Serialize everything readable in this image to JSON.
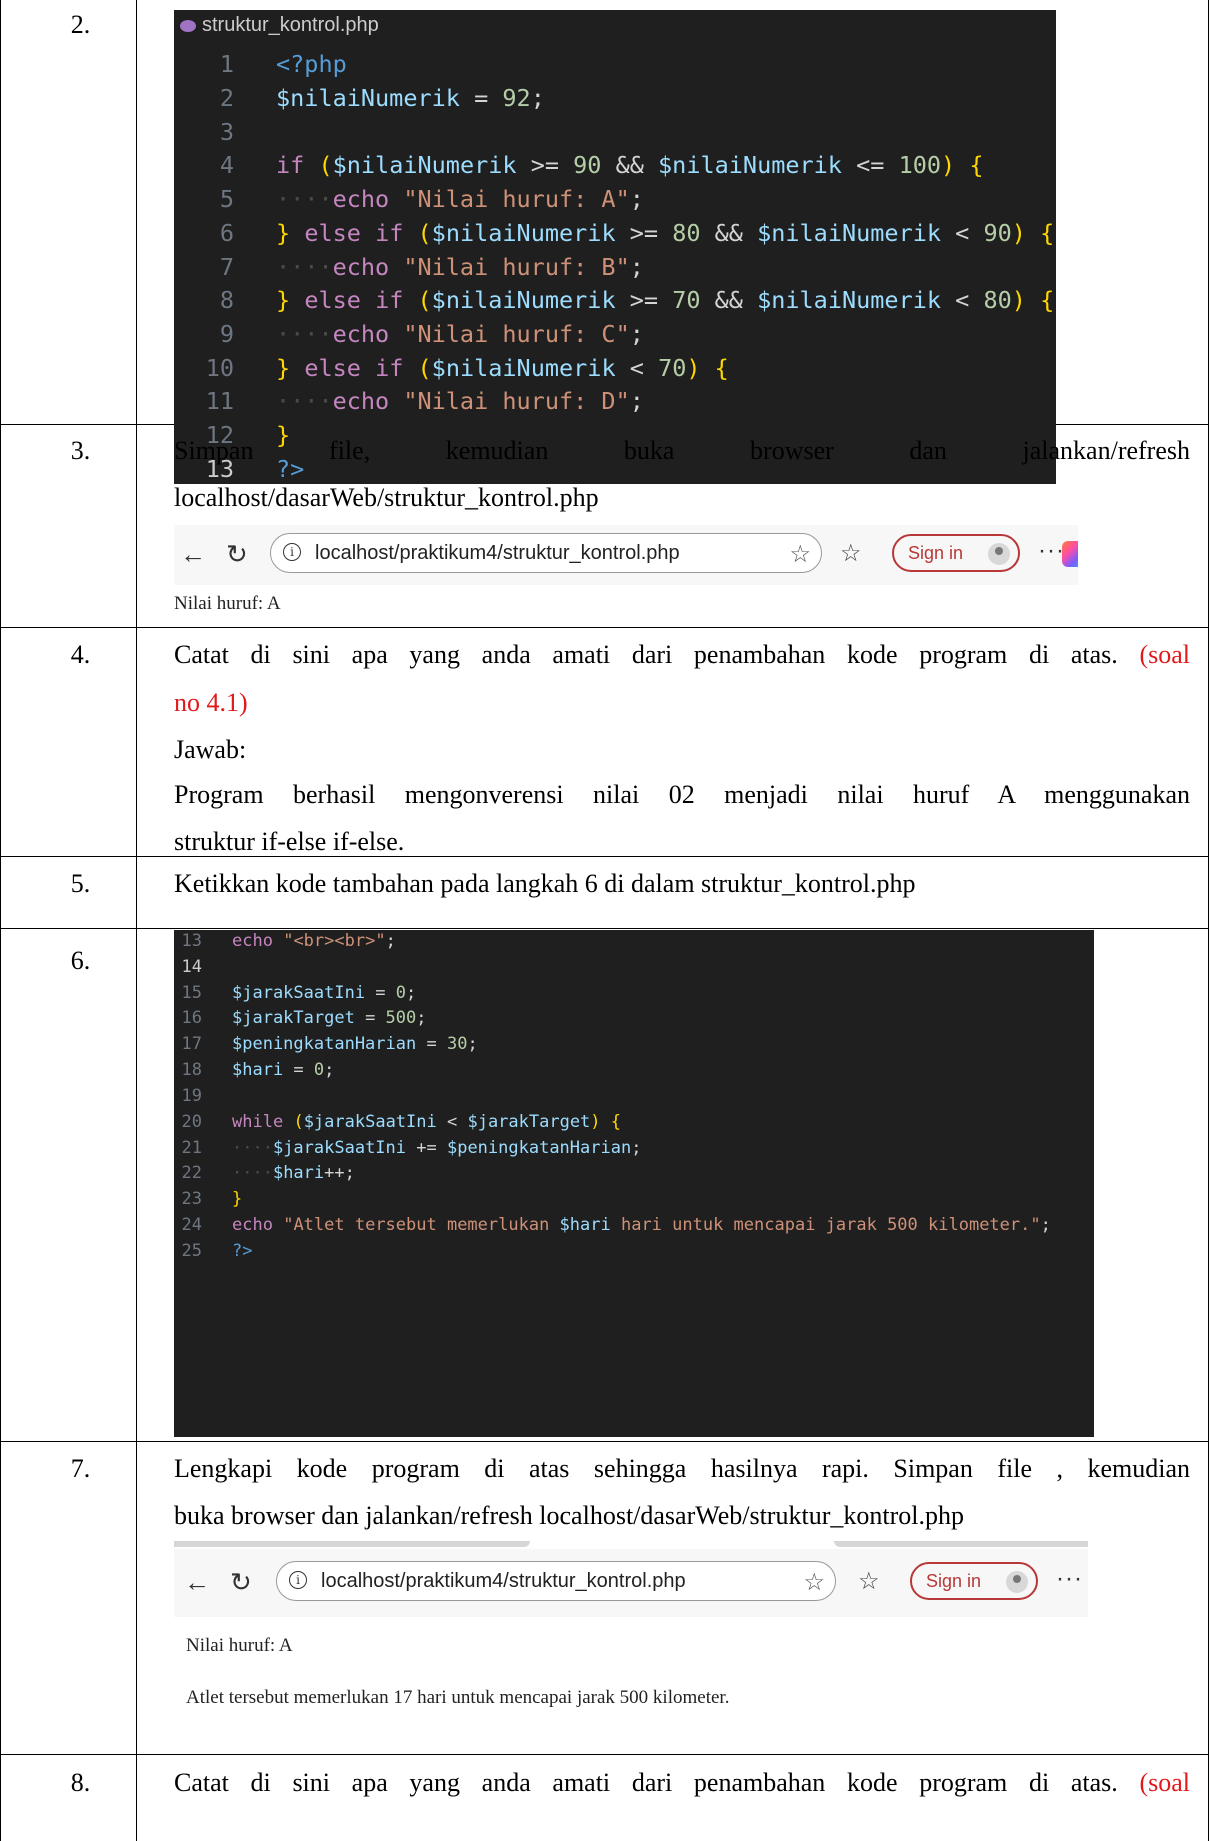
{
  "rows": {
    "r2": {
      "num": "2.",
      "editor": {
        "tab": "struktur_kontrol.php",
        "numbers": [
          "1",
          "2",
          "3",
          "4",
          "5",
          "6",
          "7",
          "8",
          "9",
          "10",
          "11",
          "12",
          "13"
        ]
      }
    },
    "r3": {
      "num": "3.",
      "line1": "Simpan file, kemudian buka browser dan jalankan/refresh",
      "line2": "localhost/dasarWeb/struktur_kontrol.php",
      "browser": {
        "url": "localhost/praktikum4/struktur_kontrol.php",
        "sign_in": "Sign in",
        "output": "Nilai huruf: A"
      }
    },
    "r4": {
      "num": "4.",
      "line1": "Catat di sini apa yang anda amati dari penambahan kode program di atas.",
      "line1_red": "(soal",
      "line2_red": "no 4.1)",
      "jawab": "Jawab:",
      "answer1": "Program berhasil mengonverensi nilai 02 menjadi nilai huruf A menggunakan",
      "answer2": "struktur if-else if-else."
    },
    "r5": {
      "num": "5.",
      "text": "Ketikkan kode tambahan pada langkah 6 di dalam struktur_kontrol.php"
    },
    "r6": {
      "num": "6.",
      "editor": {
        "numbers": [
          "13",
          "14",
          "15",
          "16",
          "17",
          "18",
          "19",
          "20",
          "21",
          "22",
          "23",
          "24",
          "25"
        ]
      }
    },
    "r7": {
      "num": "7.",
      "line1": "Lengkapi kode program di atas sehingga hasilnya rapi. Simpan file , kemudian",
      "line2": "buka browser dan jalankan/refresh localhost/dasarWeb/struktur_kontrol.php",
      "browser": {
        "url": "localhost/praktikum4/struktur_kontrol.php",
        "sign_in": "Sign in",
        "output1": "Nilai huruf: A",
        "output2": "Atlet tersebut memerlukan 17 hari untuk mencapai jarak 500 kilometer."
      }
    },
    "r8": {
      "num": "8.",
      "line1": "Catat di sini apa yang anda amati dari penambahan kode program di atas.",
      "line1_red": "(soal"
    }
  },
  "code": {
    "c1": {
      "php_open": "<?php",
      "var": "$nilaiNumerik",
      "assign": " = ",
      "value": "92",
      "semi": ";",
      "if_kw": "if",
      "else_kw": "else",
      "echo_kw": "echo",
      "ge": " >= ",
      "le": " <= ",
      "lt": " < ",
      "and": " && ",
      "n90": "90",
      "n100": "100",
      "n80": "80",
      "n70": "70",
      "str_a": "\"Nilai huruf: A\"",
      "str_b": "\"Nilai huruf: B\"",
      "str_c": "\"Nilai huruf: C\"",
      "str_d": "\"Nilai huruf: D\"",
      "php_close": "?>"
    },
    "c2": {
      "echo_kw": "echo",
      "br": "\"<br><br>\"",
      "v_jarak": "$jarakSaatIni",
      "v_target": "$jarakTarget",
      "v_pening": "$peningkatanHarian",
      "v_hari": "$hari",
      "n0": "0",
      "n500": "500",
      "n30": "30",
      "while_kw": "while",
      "pluseq": " += ",
      "incr": "++",
      "str_pre": "\"Atlet tersebut memerlukan ",
      "str_post": " hari untuk mencapai jarak 500 kilometer.\"",
      "php_close": "?>"
    }
  }
}
